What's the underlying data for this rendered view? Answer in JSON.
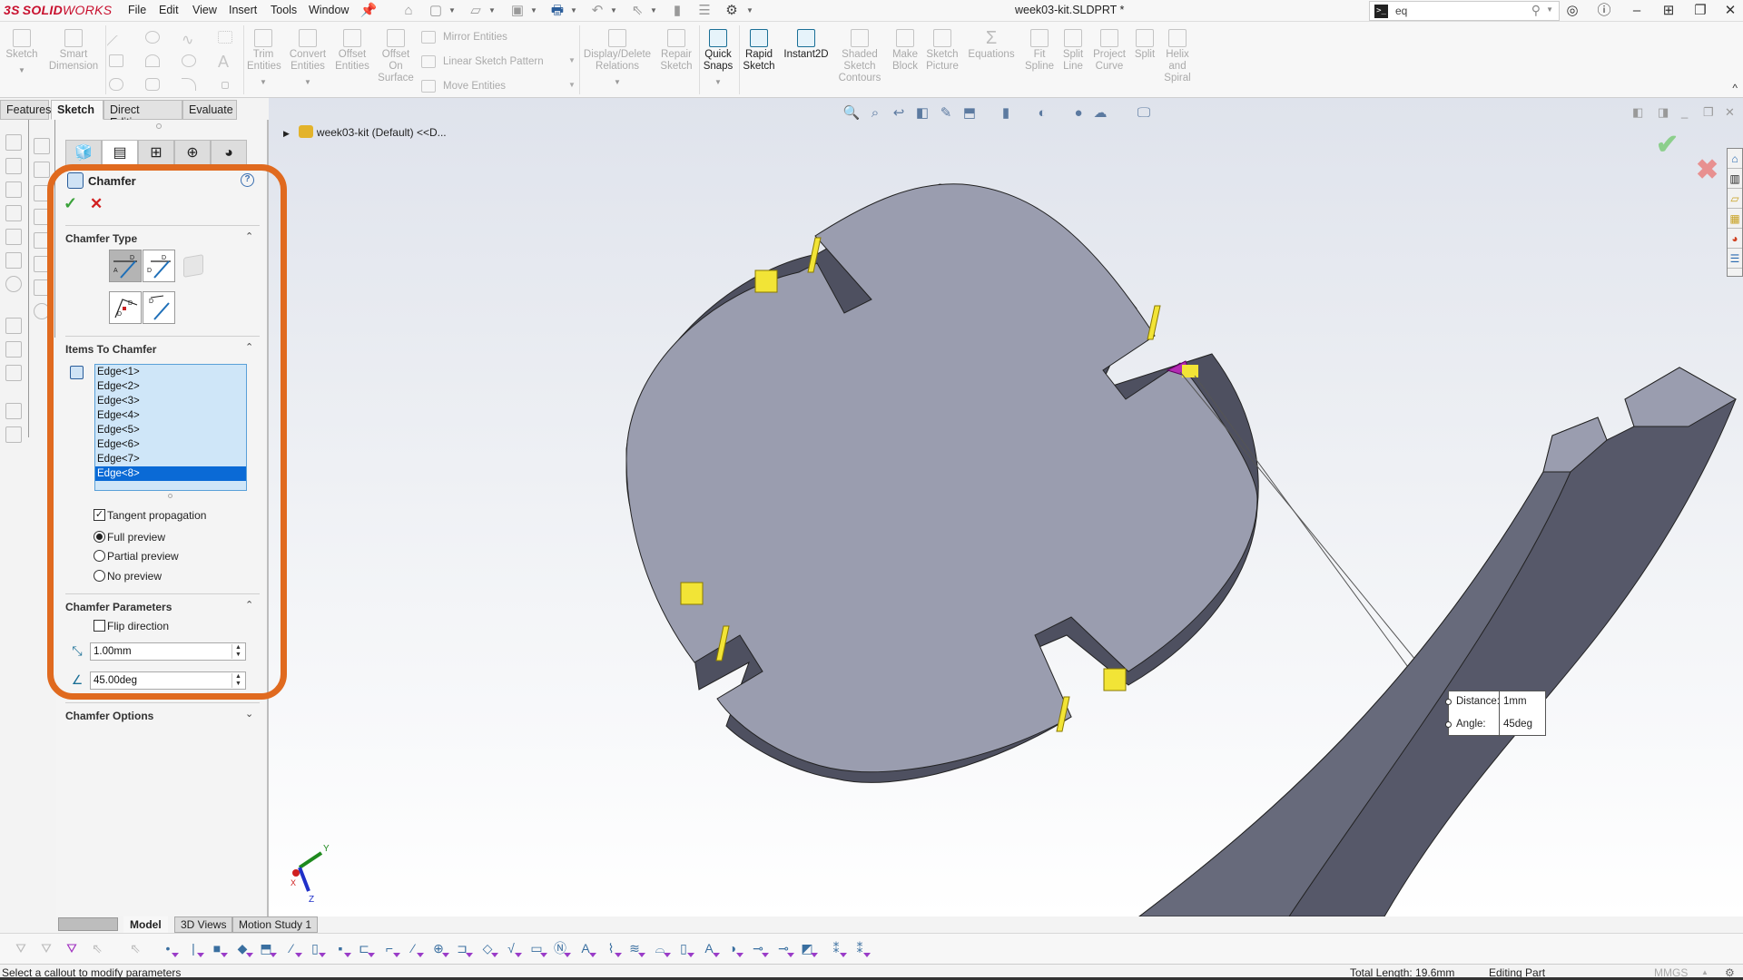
{
  "app": {
    "brand_prefix": "3S",
    "brand_bold": "SOLID",
    "brand_rest": "WORKS",
    "document_title": "week03-kit.SLDPRT *"
  },
  "menu": [
    "File",
    "Edit",
    "View",
    "Insert",
    "Tools",
    "Window"
  ],
  "command_search": {
    "value": "eq"
  },
  "ribbon": {
    "large_tools": [
      {
        "label": "Sketch",
        "enabled": false
      },
      {
        "label": "Smart\nDimension",
        "enabled": false
      },
      {
        "label": "Trim\nEntities",
        "enabled": false
      },
      {
        "label": "Convert\nEntities",
        "enabled": false
      },
      {
        "label": "Offset\nEntities",
        "enabled": false
      },
      {
        "label": "Offset\nOn\nSurface",
        "enabled": false
      },
      {
        "label": "Display/Delete\nRelations",
        "enabled": false
      },
      {
        "label": "Repair\nSketch",
        "enabled": false
      },
      {
        "label": "Quick\nSnaps",
        "enabled": true
      },
      {
        "label": "Rapid\nSketch",
        "enabled": true
      },
      {
        "label": "Instant2D",
        "enabled": true
      },
      {
        "label": "Shaded\nSketch\nContours",
        "enabled": false
      },
      {
        "label": "Make\nBlock",
        "enabled": false
      },
      {
        "label": "Sketch\nPicture",
        "enabled": false
      },
      {
        "label": "Equations",
        "enabled": false
      },
      {
        "label": "Fit\nSpline",
        "enabled": false
      },
      {
        "label": "Split\nLine",
        "enabled": false
      },
      {
        "label": "Project\nCurve",
        "enabled": false
      },
      {
        "label": "Split",
        "enabled": false
      },
      {
        "label": "Helix\nand\nSpiral",
        "enabled": false
      }
    ],
    "small_tools": [
      "Mirror Entities",
      "Linear Sketch Pattern",
      "Move Entities"
    ]
  },
  "command_tabs": [
    "Features",
    "Sketch",
    "Direct Editing",
    "Evaluate"
  ],
  "active_command_tab": "Sketch",
  "property_manager": {
    "title": "Chamfer",
    "help": "?",
    "ok": "✓",
    "cancel": "✕",
    "chamfer_type": {
      "heading": "Chamfer Type",
      "selected_index": 0,
      "types": [
        "angle-distance",
        "distance-distance",
        "vertex",
        "offset-face",
        "face-face"
      ]
    },
    "items_to_chamfer": {
      "heading": "Items To Chamfer",
      "edges": [
        "Edge<1>",
        "Edge<2>",
        "Edge<3>",
        "Edge<4>",
        "Edge<5>",
        "Edge<6>",
        "Edge<7>",
        "Edge<8>"
      ],
      "selected_edge": "Edge<8>",
      "tangent_propagation": {
        "label": "Tangent propagation",
        "checked": true
      },
      "preview_options": [
        {
          "label": "Full preview",
          "selected": true
        },
        {
          "label": "Partial preview",
          "selected": false
        },
        {
          "label": "No preview",
          "selected": false
        }
      ]
    },
    "chamfer_parameters": {
      "heading": "Chamfer Parameters",
      "flip_direction": {
        "label": "Flip direction",
        "checked": false
      },
      "distance": "1.00mm",
      "angle": "45.00deg"
    },
    "chamfer_options": {
      "heading": "Chamfer Options"
    }
  },
  "graphics": {
    "feature_tree_root": "week03-kit (Default) <<D...",
    "callout": {
      "distance_label": "Distance:",
      "distance_value": "1mm",
      "angle_label": "Angle:",
      "angle_value": "45deg"
    },
    "triad_labels": {
      "x": "X",
      "y": "Y",
      "z": "Z"
    }
  },
  "bottom_tabs": [
    "Model",
    "3D Views",
    "Motion Study 1"
  ],
  "active_bottom_tab": "Model",
  "status": {
    "message": "Select a callout to modify parameters",
    "total_length": "Total Length: 19.6mm",
    "mode": "Editing Part",
    "units": "MMGS",
    "units_arrow": "▲"
  },
  "colors": {
    "highlight_box": "#e06a1f",
    "selection_blue": "#0a6ad6",
    "list_bg": "#cfe6f8",
    "part_face": "#9a9daf",
    "part_side": "#4e5060"
  }
}
